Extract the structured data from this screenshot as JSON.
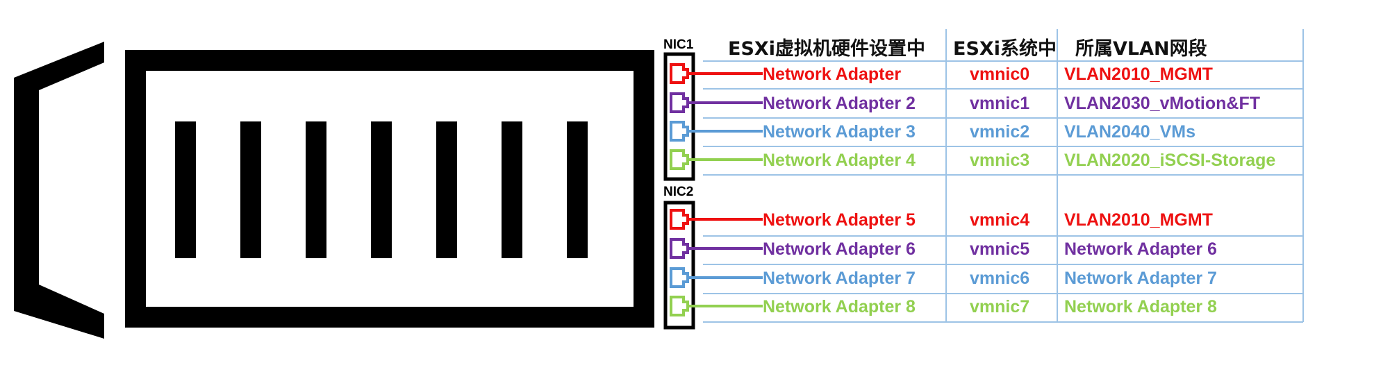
{
  "headers": {
    "vm_hw": "ESXi虚拟机硬件设置中",
    "esxi": "ESXi系统中",
    "vlan": "所属VLAN网段"
  },
  "nics": [
    {
      "label": "NIC1",
      "ports": [
        {
          "adapter": "Network Adapter",
          "vmnic": "vmnic0",
          "vlan": "VLAN2010_MGMT",
          "color": "#ee1111"
        },
        {
          "adapter": "Network Adapter 2",
          "vmnic": "vmnic1",
          "vlan": "VLAN2030_vMotion&FT",
          "color": "#7030a0"
        },
        {
          "adapter": "Network Adapter 3",
          "vmnic": "vmnic2",
          "vlan": "VLAN2040_VMs",
          "color": "#5b9bd5"
        },
        {
          "adapter": "Network Adapter 4",
          "vmnic": "vmnic3",
          "vlan": "VLAN2020_iSCSI-Storage",
          "color": "#92d050"
        }
      ]
    },
    {
      "label": "NIC2",
      "ports": [
        {
          "adapter": "Network Adapter 5",
          "vmnic": "vmnic4",
          "vlan": "VLAN2010_MGMT",
          "color": "#ee1111"
        },
        {
          "adapter": "Network Adapter 6",
          "vmnic": "vmnic5",
          "vlan": "Network Adapter 6",
          "color": "#7030a0"
        },
        {
          "adapter": "Network Adapter 7",
          "vmnic": "vmnic6",
          "vlan": "Network Adapter 7",
          "color": "#5b9bd5"
        },
        {
          "adapter": "Network Adapter 8",
          "vmnic": "vmnic7",
          "vlan": "Network Adapter 8",
          "color": "#92d050"
        }
      ]
    }
  ],
  "colors": {
    "table_line": "#9dc3e6",
    "server_fill": "#000000"
  }
}
